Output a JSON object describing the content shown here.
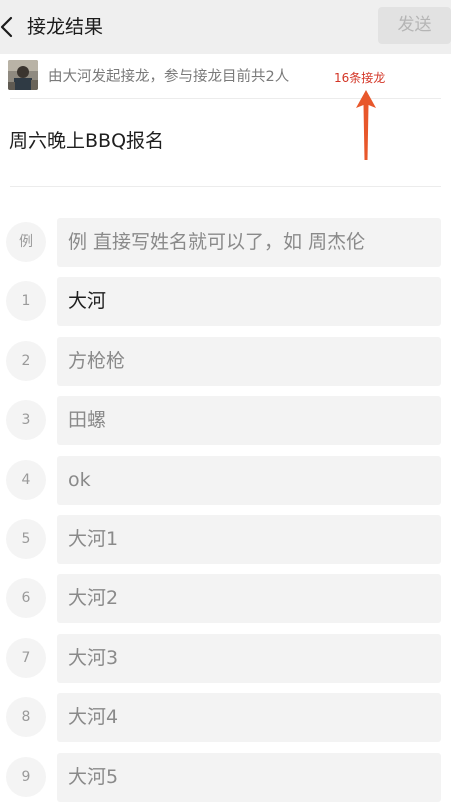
{
  "header": {
    "title": "接龙结果",
    "send_label": "发送"
  },
  "info": {
    "text": "由大河发起接龙，参与接龙目前共2人",
    "count": "16条接龙"
  },
  "topic": "周六晚上BBQ报名",
  "rows": [
    {
      "index": "例",
      "value": "例 直接写姓名就可以了，如 周杰伦",
      "entered": false
    },
    {
      "index": "1",
      "value": "大河",
      "entered": true
    },
    {
      "index": "2",
      "value": "方枪枪",
      "entered": false
    },
    {
      "index": "3",
      "value": "田螺",
      "entered": false
    },
    {
      "index": "4",
      "value": "ok",
      "entered": false
    },
    {
      "index": "5",
      "value": "大河1",
      "entered": false
    },
    {
      "index": "6",
      "value": "大河2",
      "entered": false
    },
    {
      "index": "7",
      "value": "大河3",
      "entered": false
    },
    {
      "index": "8",
      "value": "大河4",
      "entered": false
    },
    {
      "index": "9",
      "value": "大河5",
      "entered": false
    }
  ],
  "colors": {
    "topbar": "#efefef",
    "count_text": "#d33526",
    "arrow": "#e8572b"
  },
  "icons": {
    "back": "chevron-left-icon",
    "annotation": "arrow-up-icon"
  }
}
